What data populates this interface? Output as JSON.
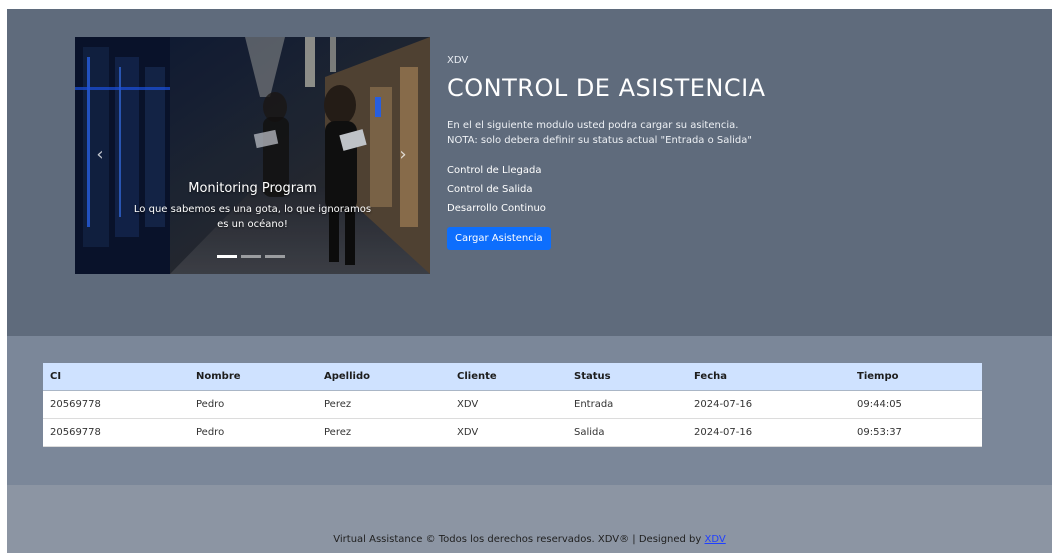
{
  "hero": {
    "brand": "XDV",
    "title": "CONTROL DE ASISTENCIA",
    "description": "En el el siguiente modulo usted podra cargar su asitencia.",
    "note": "NOTA: solo debera definir su status actual \"Entrada o Salida\"",
    "features": [
      "Control de Llegada",
      "Control de Salida",
      "Desarrollo Continuo"
    ],
    "button": "Cargar Asistencia"
  },
  "carousel": {
    "caption_title": "Monitoring Program",
    "caption_text": "Lo que sabemos es una gota, lo que ignoramos es un océano!",
    "prev_icon": "‹",
    "next_icon": "›",
    "slide_count": 3,
    "active_slide": 1
  },
  "table": {
    "headers": [
      "CI",
      "Nombre",
      "Apellido",
      "Cliente",
      "Status",
      "Fecha",
      "Tiempo"
    ],
    "rows": [
      [
        "20569778",
        "Pedro",
        "Perez",
        "XDV",
        "Entrada",
        "2024-07-16",
        "09:44:05"
      ],
      [
        "20569778",
        "Pedro",
        "Perez",
        "XDV",
        "Salida",
        "2024-07-16",
        "09:53:37"
      ]
    ]
  },
  "footer": {
    "text": "Virtual Assistance © Todos los derechos reservados. XDV® | Designed by",
    "link": "XDV"
  },
  "colors": {
    "hero_bg": "#5f6b7c",
    "section_bg": "#7b8799",
    "footer_bg": "#8c95a3",
    "primary": "#0d6efd",
    "table_header": "#cfe2ff"
  }
}
